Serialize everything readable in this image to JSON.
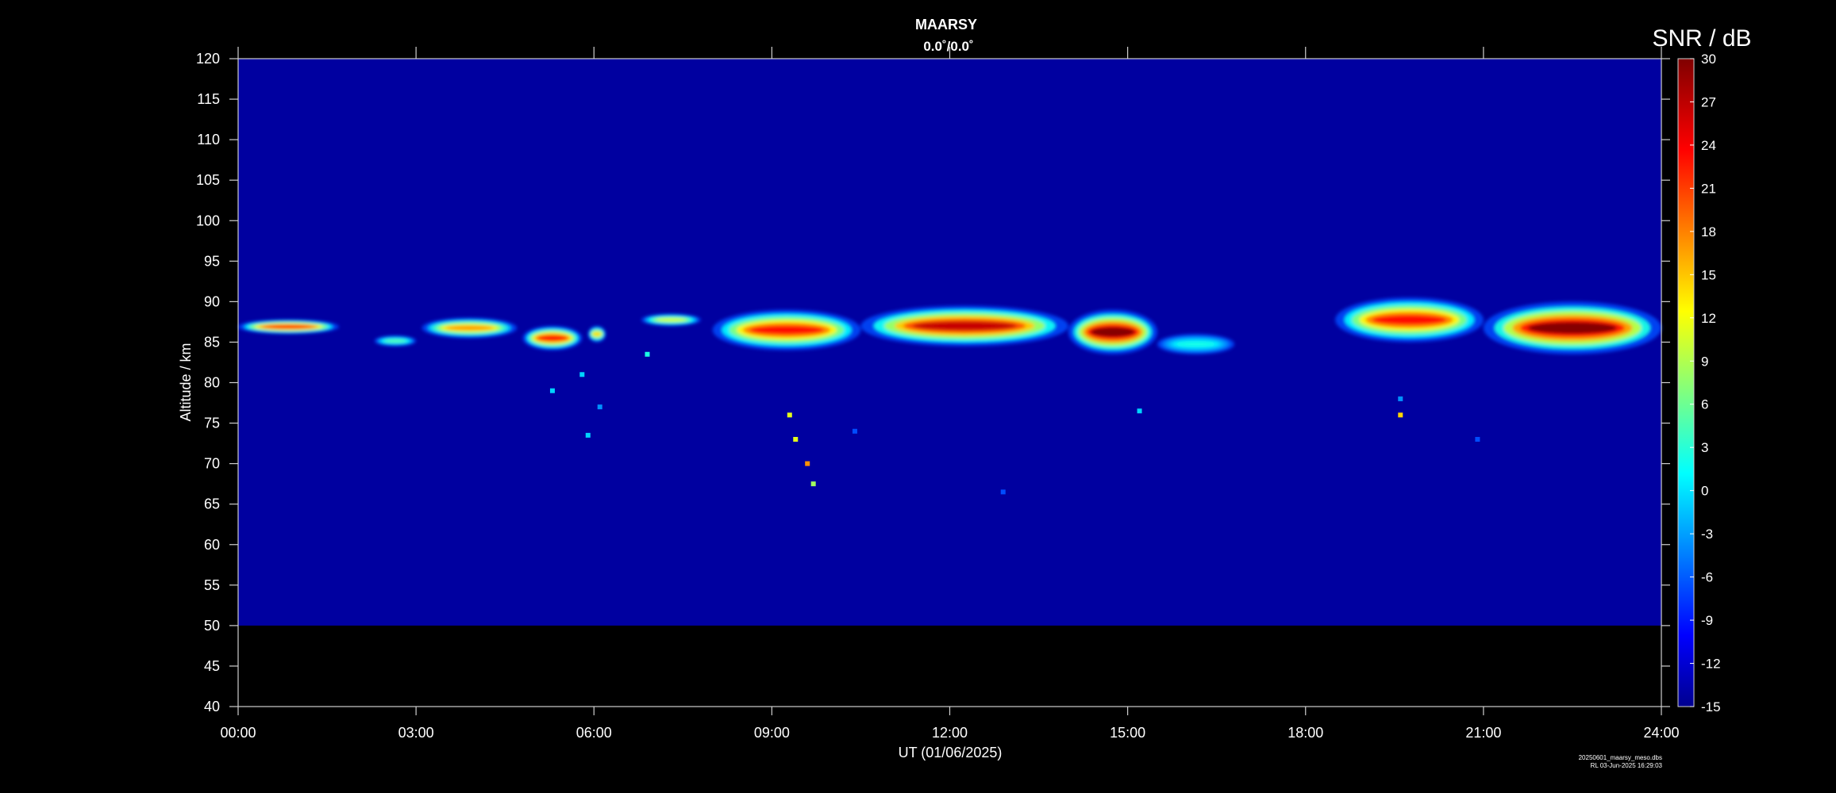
{
  "chart_data": {
    "type": "heatmap",
    "title": "MAARSY",
    "subtitle": "0.0˚/0.0˚",
    "xlabel": "UT (01/06/2025)",
    "ylabel": "Altitude / km",
    "colorbar_label": "SNR / dB",
    "xlim": [
      0,
      24
    ],
    "ylim": [
      40,
      120
    ],
    "data_ylim": [
      50,
      120
    ],
    "x_ticks": [
      "00:00",
      "03:00",
      "06:00",
      "09:00",
      "12:00",
      "15:00",
      "18:00",
      "21:00",
      "24:00"
    ],
    "x_tick_values": [
      0,
      3,
      6,
      9,
      12,
      15,
      18,
      21,
      24
    ],
    "y_ticks": [
      40,
      45,
      50,
      55,
      60,
      65,
      70,
      75,
      80,
      85,
      90,
      95,
      100,
      105,
      110,
      115,
      120
    ],
    "colorbar_range": [
      -15,
      30
    ],
    "colorbar_ticks": [
      30,
      27,
      24,
      21,
      18,
      15,
      12,
      9,
      6,
      3,
      0,
      -3,
      -6,
      -9,
      -12,
      -15
    ],
    "colormap": "jet",
    "background_snr": -11,
    "background_color": "#0000a0",
    "grid": false,
    "layers": [
      {
        "t0": 0.0,
        "t1": 1.7,
        "base": 86.0,
        "top": 87.8,
        "peak": 24
      },
      {
        "t0": 2.3,
        "t1": 3.0,
        "base": 84.5,
        "top": 85.8,
        "peak": 6
      },
      {
        "t0": 3.1,
        "t1": 4.7,
        "base": 85.5,
        "top": 88.0,
        "peak": 18
      },
      {
        "t0": 4.8,
        "t1": 5.8,
        "base": 84.0,
        "top": 87.0,
        "peak": 24
      },
      {
        "t0": 5.9,
        "t1": 6.2,
        "base": 85.0,
        "top": 87.0,
        "peak": 15
      },
      {
        "t0": 6.8,
        "t1": 7.8,
        "base": 87.0,
        "top": 88.5,
        "peak": 12
      },
      {
        "t0": 8.0,
        "t1": 10.5,
        "base": 84.0,
        "top": 89.0,
        "peak": 24
      },
      {
        "t0": 10.5,
        "t1": 14.0,
        "base": 84.5,
        "top": 89.5,
        "peak": 27
      },
      {
        "t0": 14.0,
        "t1": 15.5,
        "base": 83.5,
        "top": 89.0,
        "peak": 30
      },
      {
        "t0": 15.5,
        "t1": 16.8,
        "base": 83.5,
        "top": 86.0,
        "peak": 3
      },
      {
        "t0": 18.5,
        "t1": 21.0,
        "base": 85.0,
        "top": 90.5,
        "peak": 24
      },
      {
        "t0": 21.0,
        "t1": 24.0,
        "base": 83.5,
        "top": 90.0,
        "peak": 30
      }
    ],
    "specks": [
      {
        "t": 5.3,
        "alt": 79.0,
        "snr": 0
      },
      {
        "t": 5.8,
        "alt": 81.0,
        "snr": 0
      },
      {
        "t": 5.9,
        "alt": 73.5,
        "snr": 0
      },
      {
        "t": 6.1,
        "alt": 77.0,
        "snr": -3
      },
      {
        "t": 6.9,
        "alt": 83.5,
        "snr": 3
      },
      {
        "t": 9.3,
        "alt": 76.0,
        "snr": 12
      },
      {
        "t": 9.4,
        "alt": 73.0,
        "snr": 12
      },
      {
        "t": 9.6,
        "alt": 70.0,
        "snr": 18
      },
      {
        "t": 9.7,
        "alt": 67.5,
        "snr": 9
      },
      {
        "t": 10.4,
        "alt": 74.0,
        "snr": -6
      },
      {
        "t": 12.9,
        "alt": 66.5,
        "snr": -6
      },
      {
        "t": 15.2,
        "alt": 76.5,
        "snr": 0
      },
      {
        "t": 19.6,
        "alt": 76.0,
        "snr": 15
      },
      {
        "t": 19.6,
        "alt": 78.0,
        "snr": -3
      },
      {
        "t": 20.9,
        "alt": 73.0,
        "snr": -6
      }
    ]
  },
  "footer": {
    "file": "20250601_maarsy_meso.dbs",
    "stamp": "RL  03-Jun-2025 16:29:03"
  }
}
